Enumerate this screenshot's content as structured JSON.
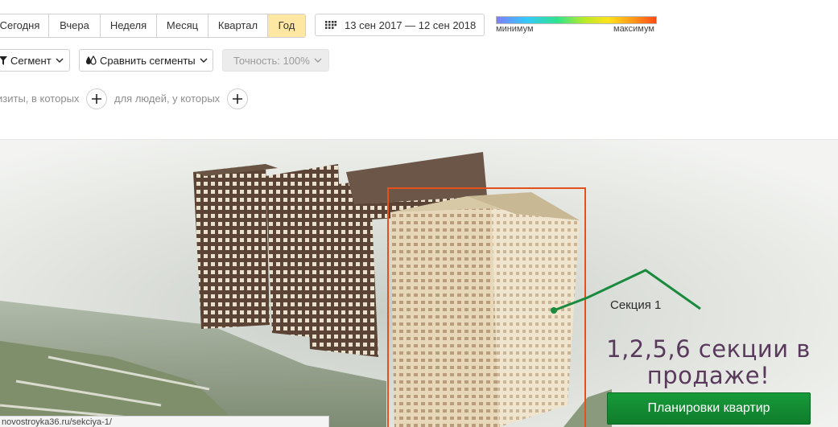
{
  "periods": [
    {
      "label": "Сегодня",
      "active": false
    },
    {
      "label": "Вчера",
      "active": false
    },
    {
      "label": "Неделя",
      "active": false
    },
    {
      "label": "Месяц",
      "active": false
    },
    {
      "label": "Квартал",
      "active": false
    },
    {
      "label": "Год",
      "active": true
    }
  ],
  "date_range": {
    "label": "13 сен 2017 — 12 сен 2018"
  },
  "legend": {
    "min_label": "минимум",
    "max_label": "максимум"
  },
  "toolbar": {
    "segment_label": "Сегмент",
    "compare_label": "Сравнить сегменты",
    "accuracy_label": "Точность: 100%"
  },
  "filters": {
    "visits_label": "изиты, в которых",
    "people_label": "для людей, у которых"
  },
  "site": {
    "section_label": "Секция 1",
    "headline_line1": "1,2,5,6 секции в",
    "headline_line2": "продаже!",
    "cta_label": "Планировки квартир",
    "status_url": "novostroyka36.ru/sekciya-1/"
  },
  "colors": {
    "active_period_bg": "#fde7a3",
    "cta_green": "#138a33",
    "headline_purple": "#5a3a5c",
    "highlight_orange": "#e5501b",
    "pointer_green": "#1a8a3c"
  }
}
